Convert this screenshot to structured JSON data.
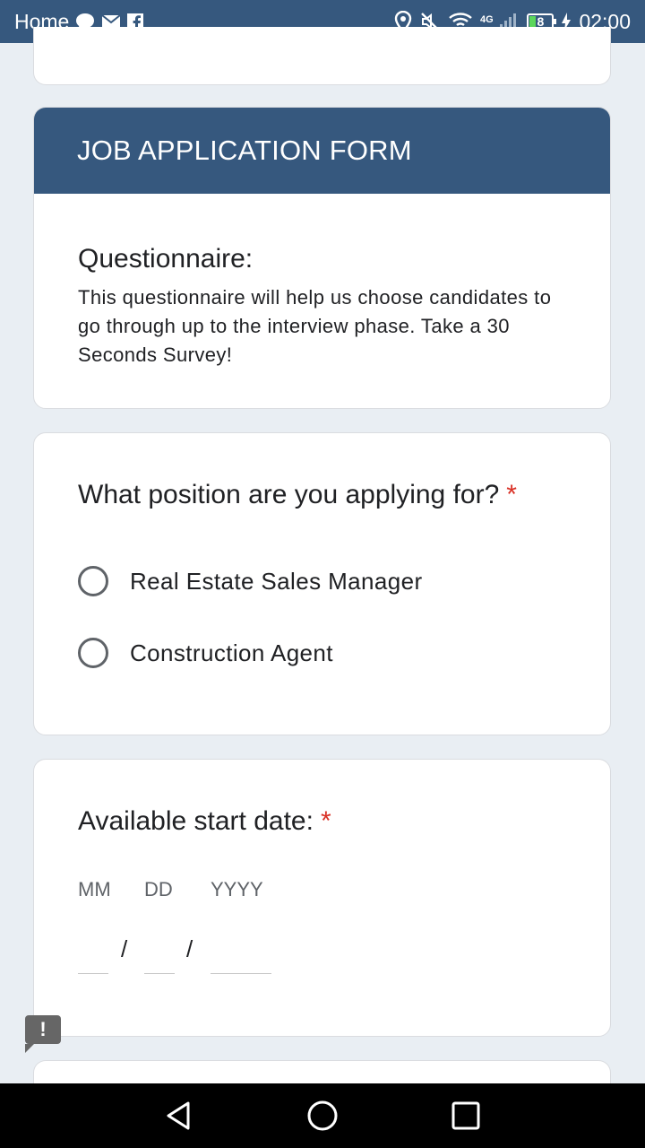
{
  "status_bar": {
    "left_label": "Home",
    "battery_level": "8",
    "time": "02:00",
    "icons": [
      "chat-icon",
      "mail-icon",
      "facebook-icon",
      "location-icon",
      "mute-icon",
      "wifi-icon",
      "signal-4g-icon",
      "battery-icon",
      "charging-icon"
    ]
  },
  "form": {
    "header_title": "JOB APPLICATION FORM",
    "section_title": "Questionnaire:",
    "section_description": "This questionnaire will help us choose candidates to go through up to the interview phase. Take a 30 Seconds Survey!"
  },
  "position_question": {
    "label": "What position are you applying for?",
    "required_mark": "*",
    "options": [
      {
        "label": "Real Estate Sales Manager",
        "selected": false
      },
      {
        "label": "Construction Agent",
        "selected": false
      }
    ]
  },
  "start_date_question": {
    "label": "Available start date:",
    "required_mark": "*",
    "month_label": "MM",
    "day_label": "DD",
    "year_label": "YYYY",
    "separator": "/",
    "month_value": "",
    "day_value": "",
    "year_value": ""
  },
  "feedback_button": {
    "label": "!"
  },
  "colors": {
    "accent": "#36587e",
    "background": "#e9eef3",
    "required": "#d93025"
  }
}
